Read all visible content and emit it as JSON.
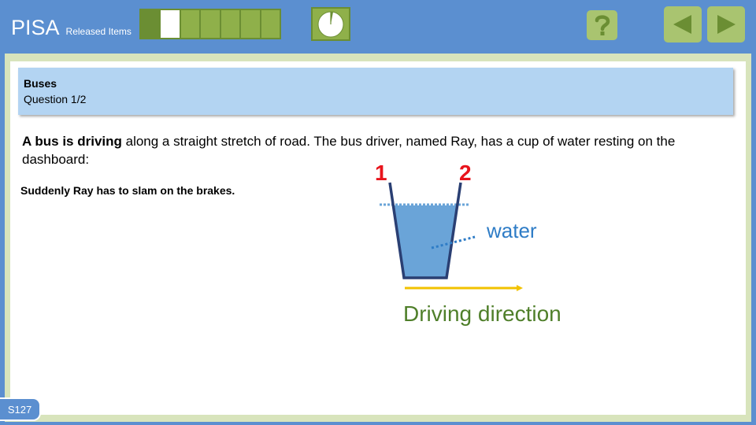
{
  "header": {
    "title": "PISA",
    "subtitle": "Released Items",
    "progress": {
      "segments": 7,
      "completed": 1,
      "current": 2
    },
    "timer": {
      "elapsed_fraction": 0.03
    }
  },
  "question": {
    "unit": "Buses",
    "number": "Question 1/2",
    "stem_bold": "A bus is driving",
    "stem_rest": " along a straight stretch of road. The bus driver, named Ray, has a cup of water resting on the dashboard:",
    "prompt": "Suddenly Ray has to slam on the brakes."
  },
  "figure": {
    "label_1": "1",
    "label_2": "2",
    "water_label": "water",
    "direction_label": "Driving direction"
  },
  "footer": {
    "page_code": "S127"
  },
  "colors": {
    "bar": "#5b8fd0",
    "progress_fill": "#8fb04a",
    "progress_border": "#6b8e33",
    "header_box": "#b3d4f2",
    "frame": "#d8e4bc",
    "label_red": "#e8141c",
    "water": "#6aa4d8",
    "water_label": "#2e7cc6",
    "arrow": "#f2c200",
    "direction_text": "#4f7f2a"
  }
}
